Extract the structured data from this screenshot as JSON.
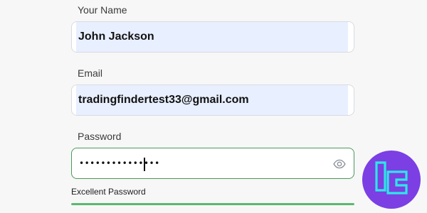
{
  "form": {
    "name": {
      "label": "Your Name",
      "value": "John Jackson"
    },
    "email": {
      "label": "Email",
      "value": "tradingfindertest33@gmail.com"
    },
    "password": {
      "label": "Password",
      "masked_value": "•••••••••••••••",
      "toggle_icon": "eye-icon"
    },
    "strength": {
      "label": "Excellent Password",
      "level": 1.0,
      "color": "#5ab96f"
    }
  },
  "brand": {
    "logo_icon": "tradingfinder-logo",
    "logo_bg": "#7b3fe4",
    "logo_stroke": "#2ee6e6"
  }
}
